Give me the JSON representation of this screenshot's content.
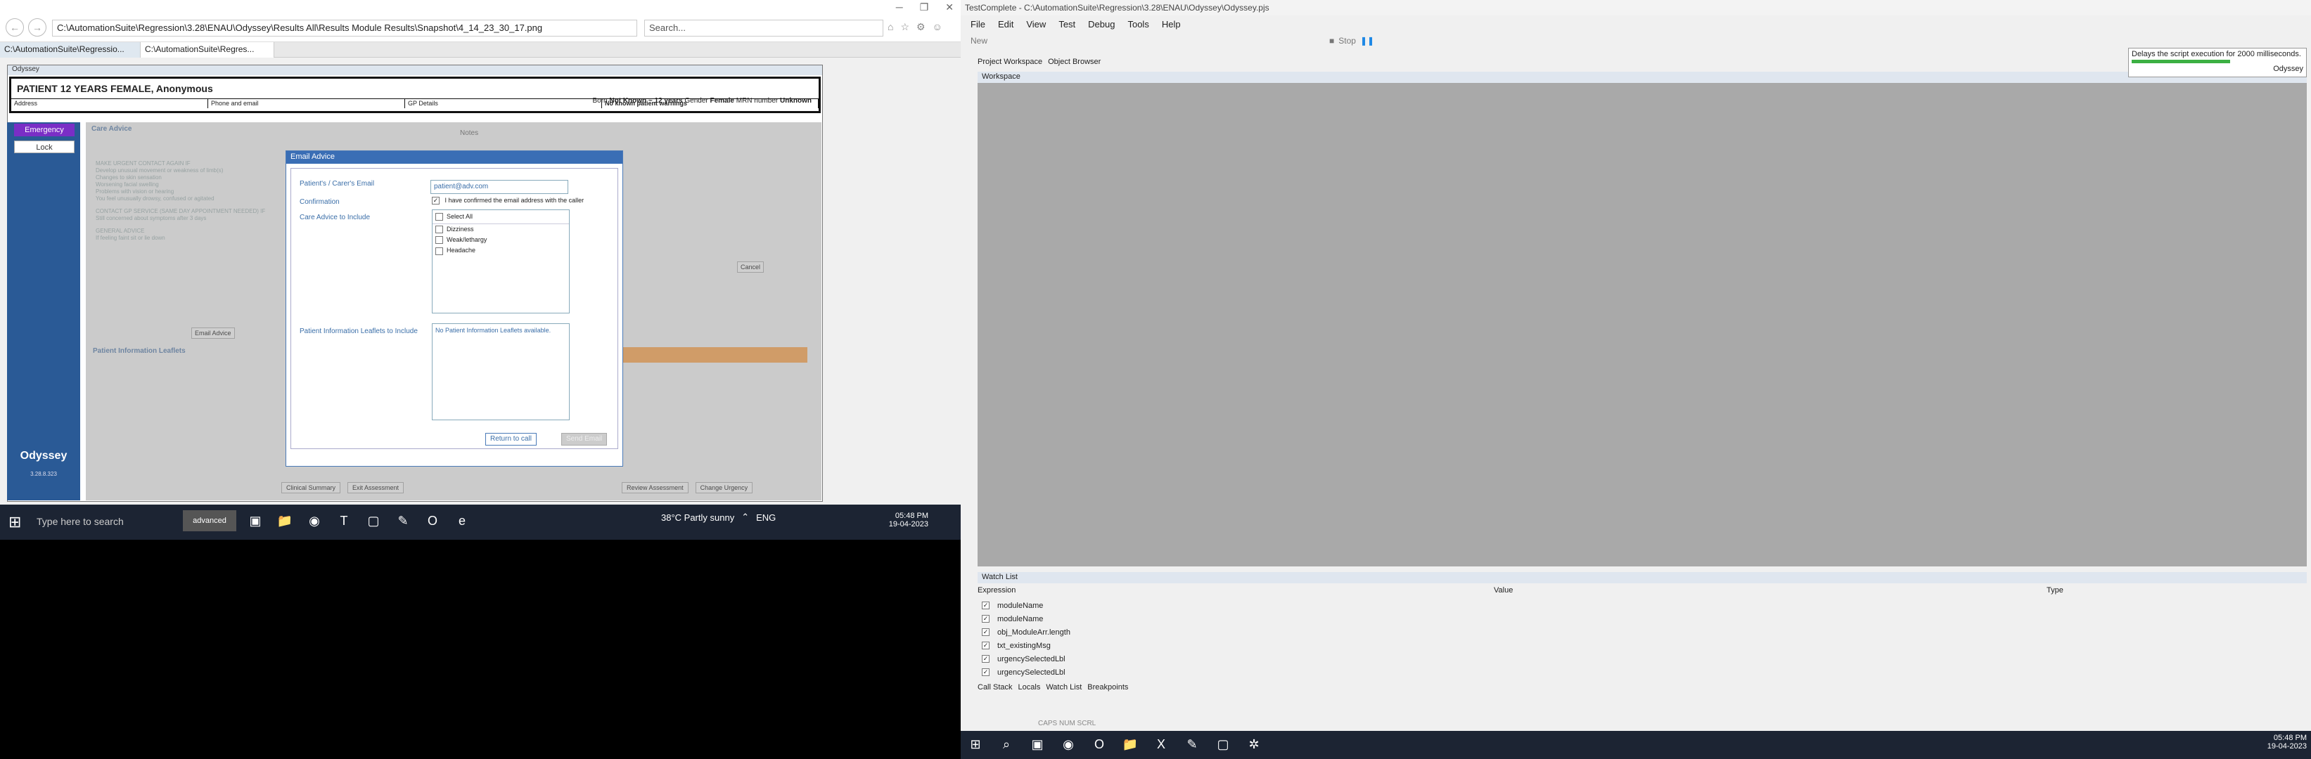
{
  "ie": {
    "address": "C:\\AutomationSuite\\Regression\\3.28\\ENAU\\Odyssey\\Results All\\Results Module Results\\Snapshot\\4_14_23_30_17.png",
    "search_placeholder": "Search...",
    "tabs": [
      "C:\\AutomationSuite\\Regressio...",
      "C:\\AutomationSuite\\Regres..."
    ]
  },
  "odyssey": {
    "window_title": "Odyssey",
    "patient_name": "PATIENT 12 YEARS FEMALE, Anonymous",
    "born": "Born",
    "born_value": "Not Known ~ 12 years",
    "gender_label": "Gender",
    "gender_value": "Female",
    "mrn_label": "MRN number",
    "mrn_value": "Unknown",
    "address_label": "Address",
    "phone_label": "Phone and email",
    "gp_label": "GP Details",
    "warnings": "No known patient warnings",
    "emergency": "Emergency",
    "lock": "Lock",
    "brand": "Odyssey",
    "version": "3.28.8.323",
    "care_advice_title": "Care Advice",
    "notes_label": "Notes",
    "pil_title": "Patient Information Leaflets",
    "care_text": [
      "MAKE URGENT CONTACT AGAIN IF",
      "Develop unusual movement or weakness of limb(s)",
      "Changes to skin sensation",
      "Worsening facial swelling",
      "Problems with vision or hearing",
      "You feel unusually drowsy, confused or agitated",
      "CONTACT GP SERVICE (SAME DAY APPOINTMENT NEEDED) IF",
      "Still concerned about symptoms after 3 days",
      "GENERAL ADVICE",
      "If feeling faint sit or lie down"
    ],
    "bottom_buttons": [
      "Clinical Summary",
      "Exit Assessment",
      "Review Assessment",
      "Change Urgency"
    ],
    "cancel": "Cancel",
    "email_advice_btn": "Email Advice"
  },
  "modal": {
    "title": "Email Advice",
    "email_label": "Patient's / Carer's Email",
    "email_value": "patient@adv.com",
    "confirmation_label": "Confirmation",
    "confirmation_text": "I have confirmed the email address with the caller",
    "care_label": "Care Advice to Include",
    "select_all": "Select All",
    "items": [
      "Dizziness",
      "Weak/lethargy",
      "Headache"
    ],
    "pil_label": "Patient Information Leaflets to Include",
    "pil_text": "No Patient Information Leaflets available.",
    "return_btn": "Return to call",
    "send_btn": "Send Email"
  },
  "taskbar_left": {
    "search": "Type here to search",
    "advanced": "advanced",
    "weather": "38°C  Partly sunny",
    "lang": "ENG",
    "time": "05:48 PM",
    "date": "19-04-2023"
  },
  "tc": {
    "title": "TestComplete - C:\\AutomationSuite\\Regression\\3.28\\ENAU\\Odyssey\\Odyssey.pjs",
    "menu": [
      "File",
      "Edit",
      "View",
      "Test",
      "Debug",
      "Tools",
      "Help"
    ],
    "new": "New",
    "stop": "Stop",
    "pane_tabs": [
      "Project Workspace",
      "Object Browser"
    ],
    "workspace": "Workspace",
    "tooltip": "Delays the script execution for 2000 milliseconds.",
    "tooltip_sub": "Odyssey",
    "watch_title": "Watch List",
    "watch_cols": [
      "Expression",
      "Value",
      "Type"
    ],
    "watch_rows": [
      "moduleName",
      "moduleName",
      "obj_ModuleArr.length",
      "txt_existingMsg",
      "urgencySelectedLbl",
      "urgencySelectedLbl"
    ],
    "bottom_tabs": [
      "Call Stack",
      "Locals",
      "Watch List",
      "Breakpoints"
    ],
    "status": "CAPS   NUM   SCRL",
    "time": "05:48 PM",
    "date": "19-04-2023"
  }
}
